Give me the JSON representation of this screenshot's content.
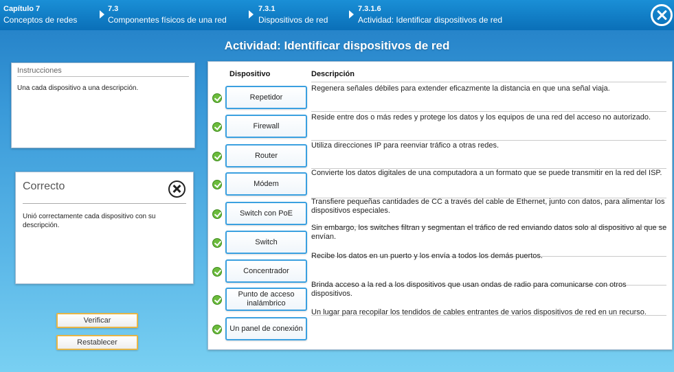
{
  "breadcrumbs": [
    {
      "num": "Capítulo 7",
      "text": "Conceptos de redes"
    },
    {
      "num": "7.3",
      "text": "Componentes físicos de una red"
    },
    {
      "num": "7.3.1",
      "text": "Dispositivos de red"
    },
    {
      "num": "7.3.1.6",
      "text": "Actividad: Identificar dispositivos de red"
    }
  ],
  "activity_title": "Actividad: Identificar dispositivos de red",
  "instructions": {
    "heading": "Instrucciones",
    "body": "Una cada dispositivo a una descripción."
  },
  "feedback": {
    "heading": "Correcto",
    "body": "Unió correctamente cada dispositivo con su descripción."
  },
  "buttons": {
    "verify": "Verificar",
    "reset": "Restablecer"
  },
  "table": {
    "col_device": "Dispositivo",
    "col_description": "Descripción",
    "devices": [
      {
        "label": "Repetidor",
        "status": "correct"
      },
      {
        "label": "Firewall",
        "status": "correct"
      },
      {
        "label": "Router",
        "status": "correct"
      },
      {
        "label": "Módem",
        "status": "correct"
      },
      {
        "label": "Switch con PoE",
        "status": "correct"
      },
      {
        "label": "Switch",
        "status": "correct"
      },
      {
        "label": "Concentrador",
        "status": "correct"
      },
      {
        "label": "Punto de acceso inalámbrico",
        "status": "correct"
      },
      {
        "label": "Un panel de conexión",
        "status": "correct"
      }
    ],
    "descriptions": [
      "Regenera señales débiles para extender eficazmente la distancia en que una señal viaja.",
      "Reside entre dos o más redes y protege los datos y los equipos de una red del acceso no autorizado.",
      "Utiliza direcciones IP para reenviar tráfico a otras redes.",
      "Convierte los datos digitales de una computadora a un formato que se puede transmitir en la red del ISP.",
      "Transfiere pequeñas cantidades de CC a través del cable de Ethernet, junto con datos, para alimentar los dispositivos especiales.",
      "Sin embargo, los switches filtran y segmentan el tráfico de red enviando datos solo al dispositivo al que se envían.",
      "Recibe los datos en un puerto y los envía a todos los demás puertos.",
      "Brinda acceso a la red a los dispositivos que usan ondas de radio para comunicarse con otros dispositivos.",
      "Un lugar para recopilar los tendidos de cables entrantes de varios dispositivos de red en un recurso."
    ]
  },
  "colors": {
    "accent": "#0a6fb8",
    "button_border": "#3aa0e0",
    "check": "#6cbb3c",
    "gold": "#e8b544"
  }
}
